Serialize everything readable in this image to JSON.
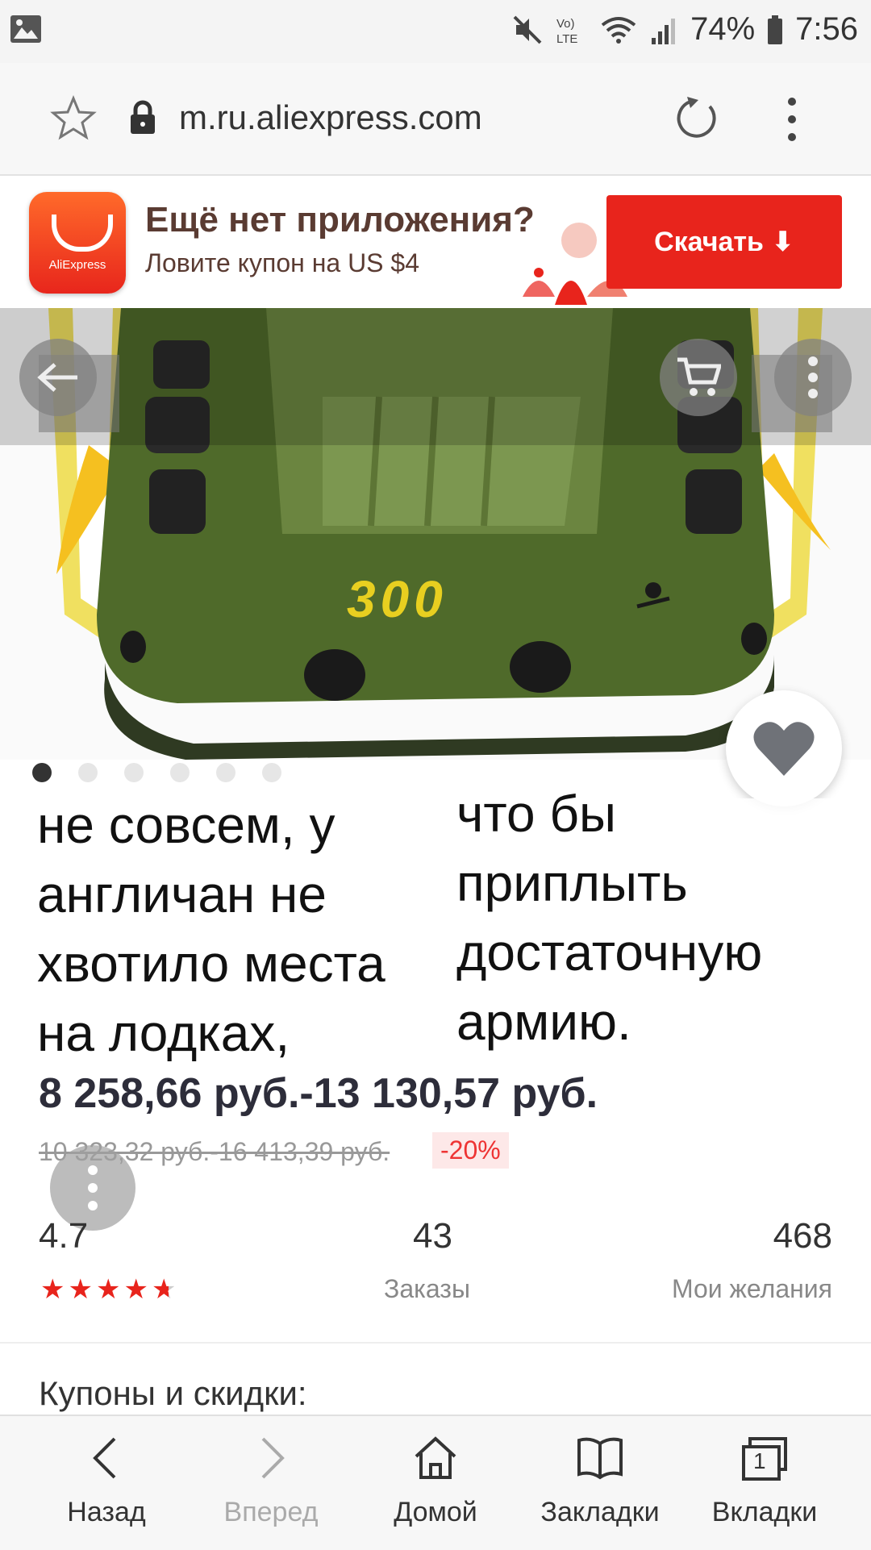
{
  "status_bar": {
    "battery": "74%",
    "time": "7:56"
  },
  "address_bar": {
    "url": "m.ru.aliexpress.com"
  },
  "banner": {
    "logo_text": "AliExpress",
    "title": "Ещё нет приложения?",
    "subtitle": "Ловите купон на US $4",
    "button_label": "Скачать ⬇"
  },
  "product": {
    "image_label": "300",
    "gallery": {
      "count": 6,
      "active_index": 0
    }
  },
  "caption": {
    "left": "не совсем, у англичан не хвотило места на лодках,",
    "right": "что бы приплыть достаточную армию."
  },
  "pricing": {
    "price": "8 258,66 руб.-13 130,57 руб.",
    "old_price": "10 323,32 руб.-16 413,39 руб.",
    "discount": "-20%"
  },
  "stats": {
    "rating": "4.7",
    "orders_count": "43",
    "orders_label": "Заказы",
    "wishlist_count": "468",
    "wishlist_label": "Мои желания"
  },
  "coupons_heading": "Купоны и скидки:",
  "bottom_nav": [
    {
      "label": "Назад",
      "icon": "back-icon"
    },
    {
      "label": "Вперед",
      "icon": "forward-icon"
    },
    {
      "label": "Домой",
      "icon": "home-icon"
    },
    {
      "label": "Закладки",
      "icon": "bookmarks-icon"
    },
    {
      "label": "Вкладки",
      "icon": "tabs-icon",
      "badge": "1"
    }
  ]
}
